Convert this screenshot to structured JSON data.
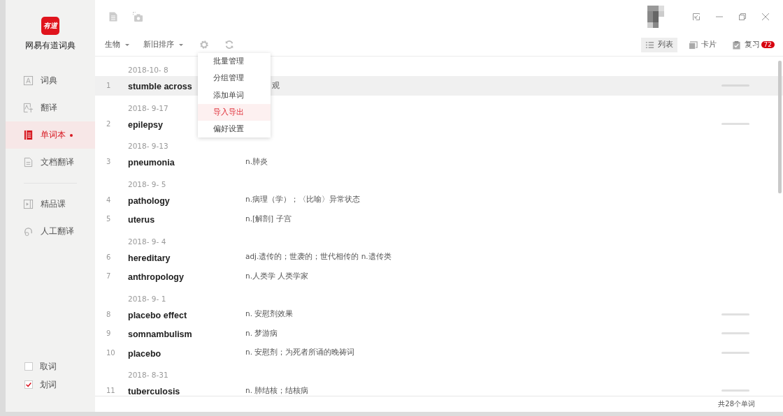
{
  "app": {
    "name": "网易有道词典",
    "logo": "有道"
  },
  "nav": [
    {
      "label": "词典",
      "selected": false,
      "dot": false
    },
    {
      "label": "翻译",
      "selected": false,
      "dot": false
    },
    {
      "label": "单词本",
      "selected": true,
      "dot": true
    },
    {
      "label": "文档翻译",
      "selected": false,
      "dot": false
    },
    {
      "label": "精品课",
      "selected": false,
      "dot": false
    },
    {
      "label": "人工翻译",
      "selected": false,
      "dot": false
    }
  ],
  "options": [
    {
      "label": "取词",
      "checked": false
    },
    {
      "label": "划词",
      "checked": true
    }
  ],
  "filters": [
    {
      "label": "生物"
    },
    {
      "label": "新旧排序"
    }
  ],
  "views": [
    {
      "label": "列表",
      "selected": true
    },
    {
      "label": "卡片",
      "selected": false
    },
    {
      "label": "复习",
      "selected": false,
      "badge": "72"
    }
  ],
  "menu": [
    {
      "label": "批量管理",
      "selected": false
    },
    {
      "label": "分组管理",
      "selected": false
    },
    {
      "label": "添加单词",
      "selected": false
    },
    {
      "label": "导入导出",
      "selected": true
    },
    {
      "label": "偏好设置",
      "selected": false
    }
  ],
  "groups": [
    {
      "date": "2018-10- 8",
      "words": [
        {
          "index": "1",
          "word": "stumble across",
          "meaning": "观",
          "meaning_cut": true,
          "hovered": true,
          "bar": true
        }
      ]
    },
    {
      "date": "2018- 9-17",
      "words": [
        {
          "index": "2",
          "word": "epilepsy",
          "hovered": false,
          "bar": true
        }
      ]
    },
    {
      "date": "2018- 9-13",
      "words": [
        {
          "index": "3",
          "word": "pneumonia",
          "meaning": "n.肺炎",
          "hovered": false,
          "bar": false
        }
      ]
    },
    {
      "date": "2018- 9- 5",
      "words": [
        {
          "index": "4",
          "word": "pathology",
          "meaning": "n.病理（学）；〈比喻〉异常状态",
          "hovered": false,
          "bar": false
        },
        {
          "index": "5",
          "word": "uterus",
          "meaning": "n.[解剖] 子宫",
          "hovered": false,
          "bar": false
        }
      ]
    },
    {
      "date": "2018- 9- 4",
      "words": [
        {
          "index": "6",
          "word": "hereditary",
          "meaning": "adj.遗传的；世袭的；世代相传的 n.遗传类",
          "hovered": false,
          "bar": false
        },
        {
          "index": "7",
          "word": "anthropology",
          "meaning": "n.人类学 人类学家",
          "hovered": false,
          "bar": false
        }
      ]
    },
    {
      "date": "2018- 9- 1",
      "words": [
        {
          "index": "8",
          "word": "placebo effect",
          "meaning": "n. 安慰剂效果",
          "hovered": false,
          "bar": true
        },
        {
          "index": "9",
          "word": "somnambulism",
          "meaning": "n. 梦游病",
          "hovered": false,
          "bar": true
        },
        {
          "index": "10",
          "word": "placebo",
          "meaning": "n. 安慰剂；为死者所诵的晚祷词",
          "hovered": false,
          "bar": true
        }
      ]
    },
    {
      "date": "2018- 8-31",
      "words": [
        {
          "index": "11",
          "word": "tuberculosis",
          "meaning": "n. 肺结核；结核病",
          "hovered": false,
          "bar": true
        }
      ]
    }
  ],
  "status": "共28个单词"
}
